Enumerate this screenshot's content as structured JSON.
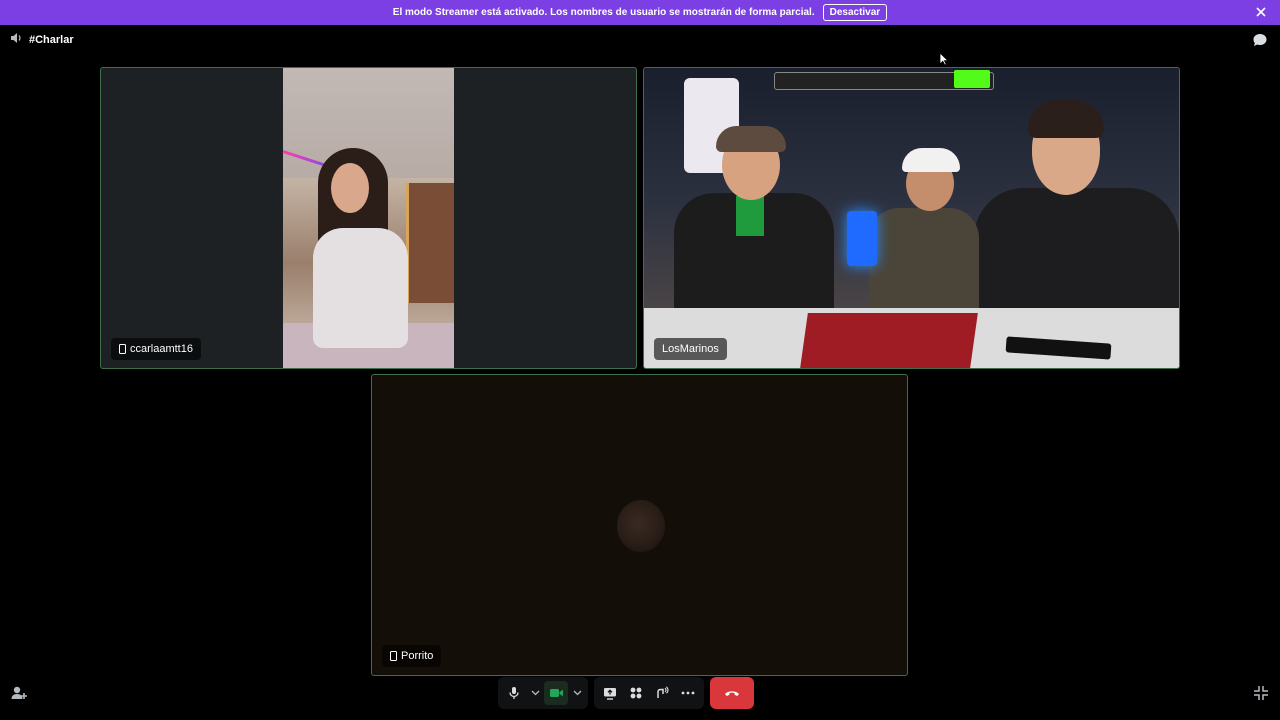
{
  "banner": {
    "message": "El modo Streamer está activado. Los nombres de usuario se mostrarán de forma parcial.",
    "button": "Desactivar",
    "close_icon": "close-icon",
    "color": "#7b3fe4"
  },
  "topbar": {
    "channel": "#Charlar",
    "speaker_icon": "speaker-icon",
    "chat_icon": "chat-bubble-icon"
  },
  "tiles": [
    {
      "name": "ccarlaamtt16",
      "device_icon": "phone-icon"
    },
    {
      "name": "LosMarinos"
    },
    {
      "name": "Porrito",
      "device_icon": "phone-icon"
    }
  ],
  "controls": {
    "mic_icon": "microphone-icon",
    "camera_icon": "camera-icon",
    "share_icon": "screen-share-icon",
    "activities_icon": "activities-icon",
    "soundboard_icon": "soundboard-icon",
    "more_icon": "more-icon",
    "hangup_icon": "hang-up-icon",
    "accent": "#da373c",
    "camera_color": "#23a55a"
  },
  "corner": {
    "invite_icon": "add-user-icon",
    "minimize_icon": "minimize-icon"
  }
}
